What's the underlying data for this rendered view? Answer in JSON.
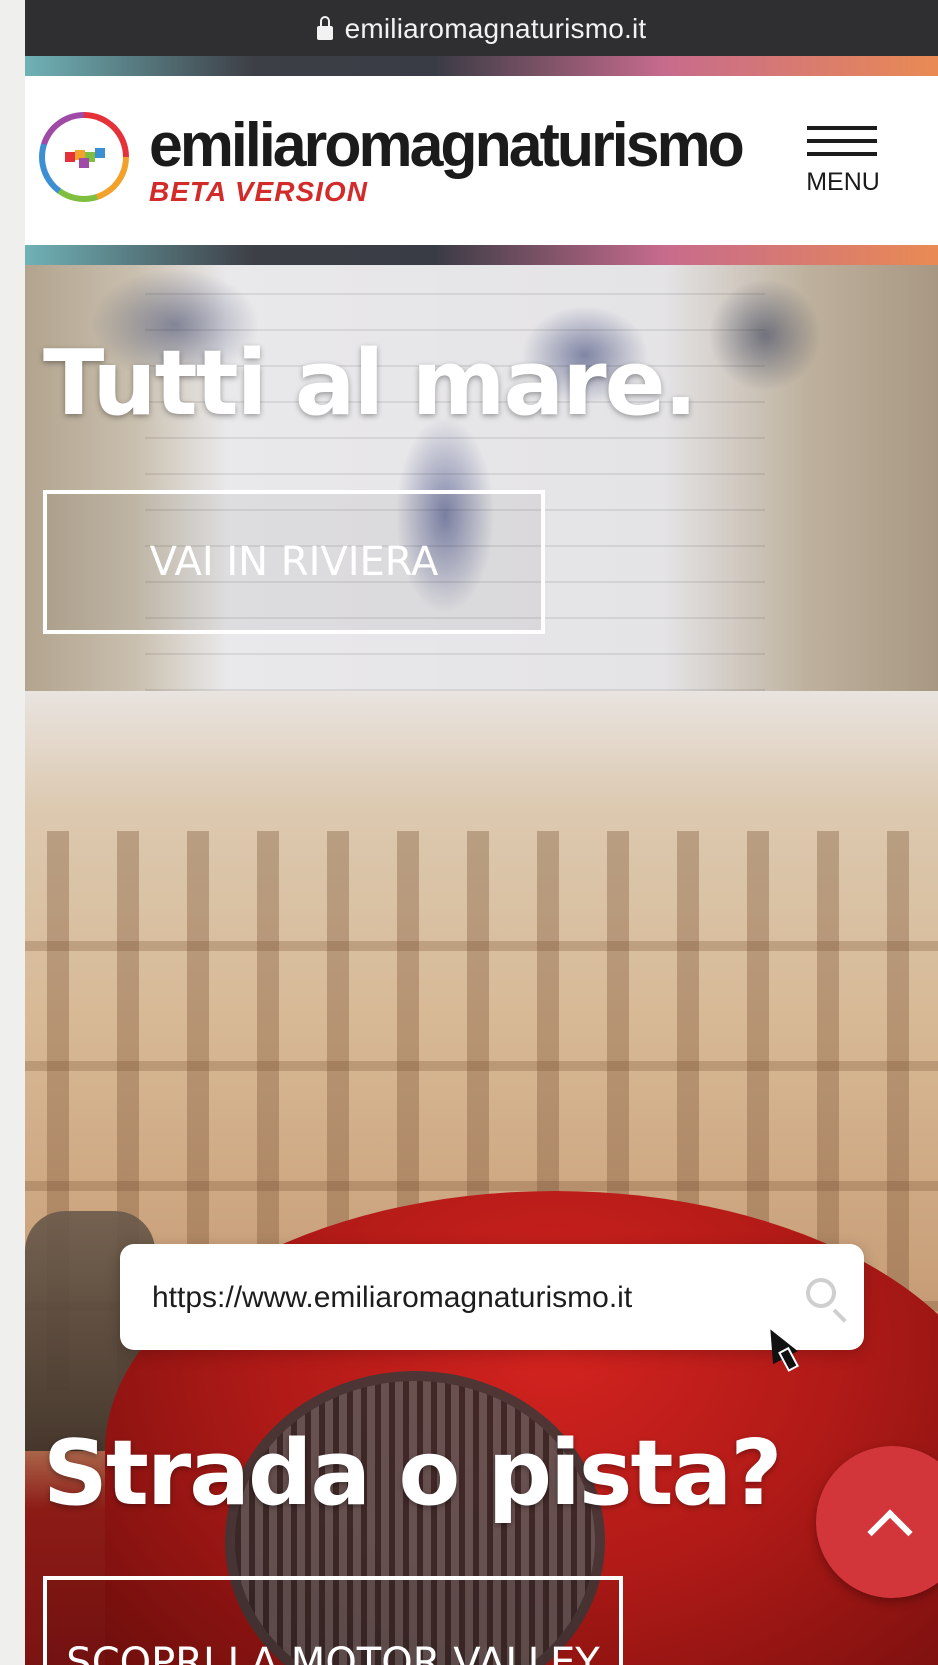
{
  "browser": {
    "url": "emiliaromagnaturismo.it",
    "lock_icon": "lock-icon"
  },
  "header": {
    "brand": "emiliaromagnaturismo",
    "badge": "BETA VERSION",
    "menu_label": "MENU",
    "logo_icon": "logo-circle-icon",
    "menu_icon": "hamburger-icon"
  },
  "hero_sea": {
    "title": "Tutti al mare.",
    "button": "VAI IN RIVIERA"
  },
  "hero_motor": {
    "title": "Strada o pista?",
    "button": "SCOPRI LA MOTOR VALLEY"
  },
  "search": {
    "value": "https://www.emiliaromagnaturismo.it",
    "icon": "search-icon"
  },
  "scroll_top": {
    "icon": "chevron-up-icon"
  },
  "colors": {
    "accent_red": "#d3363a",
    "beta_red": "#d32a2a",
    "url_bar": "#2f2f31"
  }
}
